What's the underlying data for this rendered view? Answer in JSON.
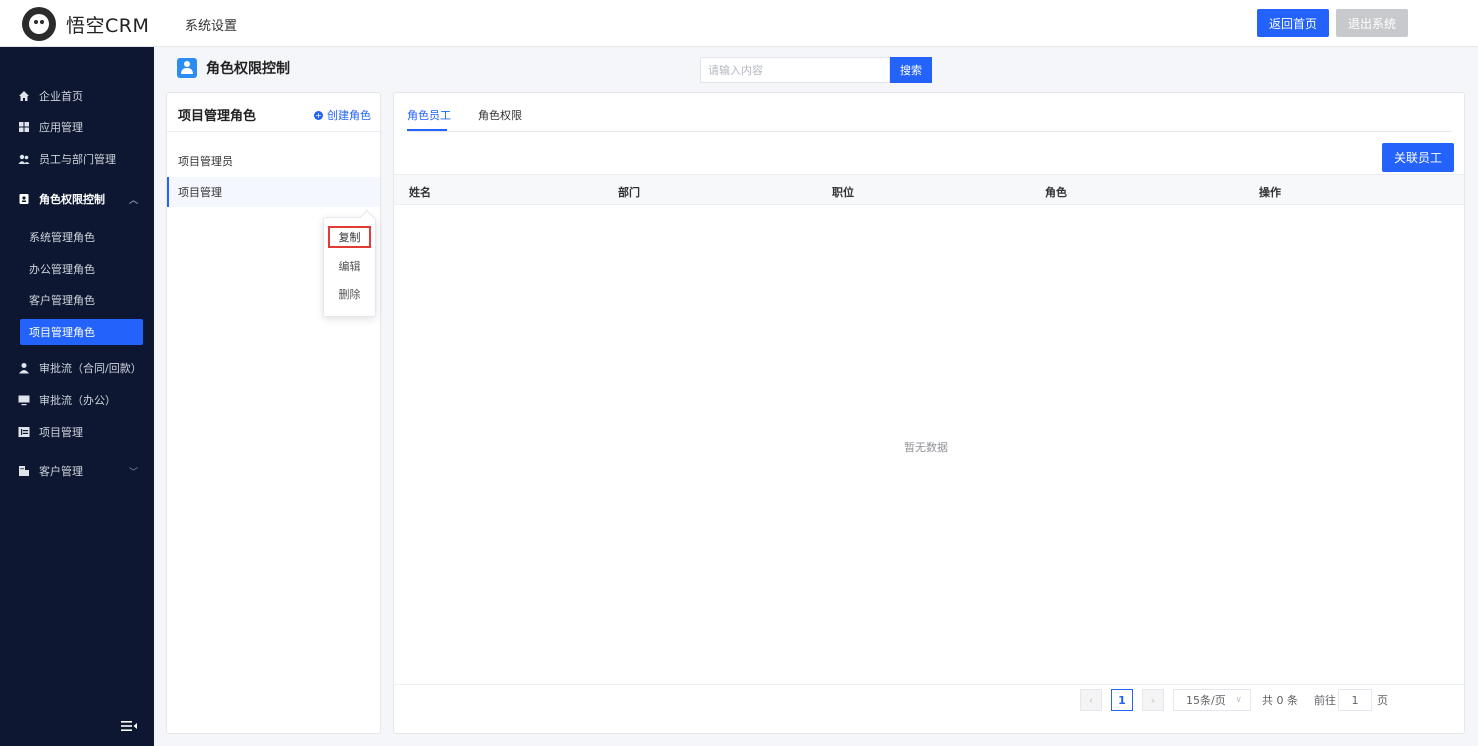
{
  "header": {
    "logo_text": "悟空CRM",
    "title": "系统设置",
    "home_button": "返回首页",
    "exit_button": "退出系统"
  },
  "sidebar": {
    "items": [
      {
        "label": "企业首页",
        "icon": "home-icon"
      },
      {
        "label": "应用管理",
        "icon": "apps-icon"
      },
      {
        "label": "员工与部门管理",
        "icon": "users-icon"
      },
      {
        "label": "角色权限控制",
        "icon": "role-icon"
      },
      {
        "label": "审批流（合同/回款）",
        "icon": "user-icon"
      },
      {
        "label": "审批流（办公）",
        "icon": "monitor-icon"
      },
      {
        "label": "项目管理",
        "icon": "project-icon"
      },
      {
        "label": "客户管理",
        "icon": "customer-icon"
      }
    ],
    "sub_items": [
      "系统管理角色",
      "办公管理角色",
      "客户管理角色",
      "项目管理角色"
    ],
    "active_sub": "项目管理角色"
  },
  "section": {
    "title": "角色权限控制",
    "search_placeholder": "请输入内容",
    "search_button": "搜索"
  },
  "left_panel": {
    "title": "项目管理角色",
    "create_label": "创建角色",
    "roles": [
      "项目管理员",
      "项目管理"
    ],
    "selected_role": "项目管理"
  },
  "context_menu": {
    "items": [
      "复制",
      "编辑",
      "删除"
    ],
    "highlighted": "复制"
  },
  "right_panel": {
    "tabs": [
      "角色员工",
      "角色权限"
    ],
    "active_tab": "角色员工",
    "link_button": "关联员工",
    "columns": [
      "姓名",
      "部门",
      "职位",
      "角色",
      "操作"
    ],
    "empty_text": "暂无数据"
  },
  "pagination": {
    "current_page": "1",
    "page_size": "15条/页",
    "total": "共 0 条",
    "goto_label": "前往",
    "goto_value": "1",
    "page_suffix": "页"
  },
  "colors": {
    "primary": "#2362fb",
    "sidebar_bg": "#0d1731",
    "highlight_border": "#e53935"
  }
}
